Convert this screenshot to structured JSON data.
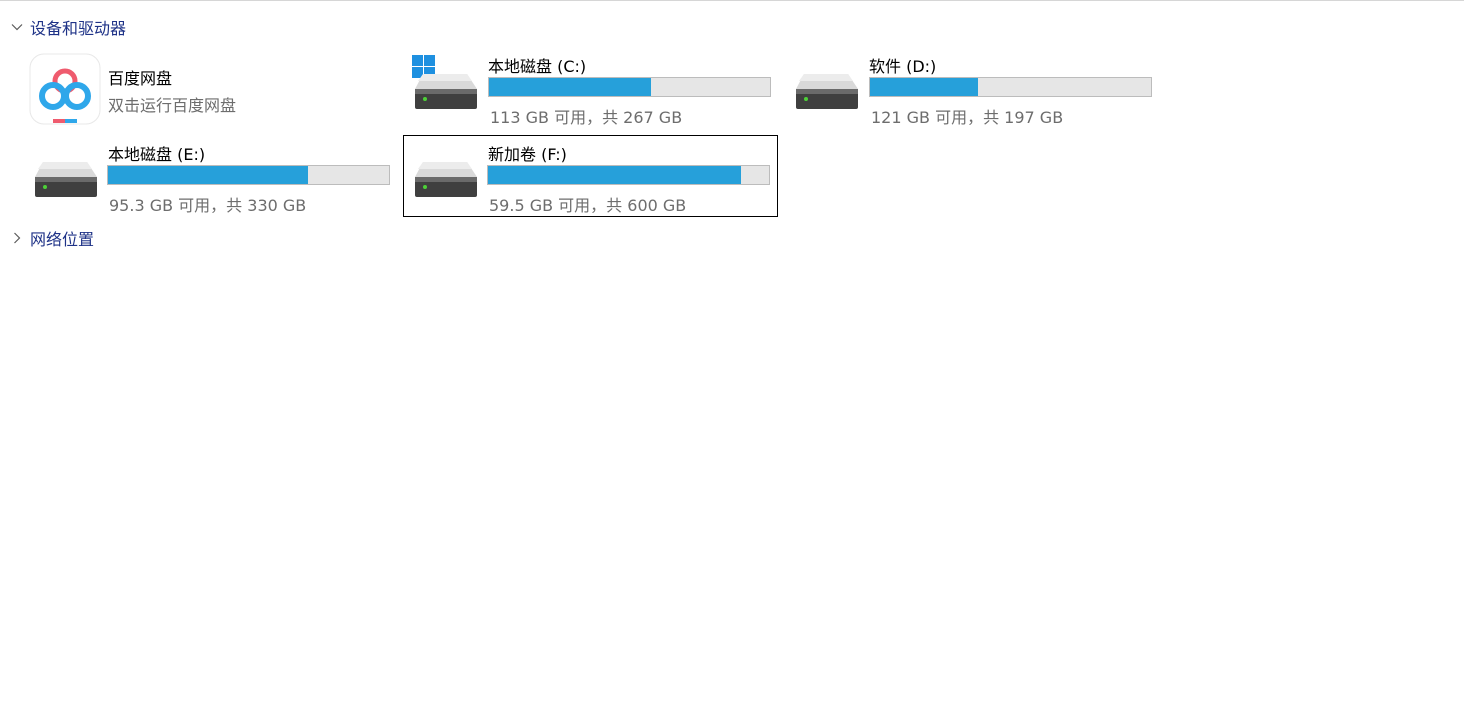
{
  "groups": {
    "devices": {
      "label": "设备和驱动器",
      "expanded": true
    },
    "network": {
      "label": "网络位置",
      "expanded": false
    }
  },
  "app": {
    "name": "百度网盘",
    "subtitle": "双击运行百度网盘",
    "icon": "baidu-netdisk-icon"
  },
  "drives": [
    {
      "id": "c",
      "name": "本地磁盘 (C:)",
      "usage": "113 GB 可用，共 267 GB",
      "used_fraction": 0.577,
      "icon": "system-drive-icon",
      "selected": false
    },
    {
      "id": "d",
      "name": "软件 (D:)",
      "usage": "121 GB 可用，共 197 GB",
      "used_fraction": 0.386,
      "icon": "hard-drive-icon",
      "selected": false
    },
    {
      "id": "e",
      "name": "本地磁盘 (E:)",
      "usage": "95.3 GB 可用，共 330 GB",
      "used_fraction": 0.711,
      "icon": "hard-drive-icon",
      "selected": false
    },
    {
      "id": "f",
      "name": "新加卷 (F:)",
      "usage": "59.5 GB 可用，共 600 GB",
      "used_fraction": 0.901,
      "icon": "hard-drive-icon",
      "selected": true
    }
  ],
  "colors": {
    "bar_fill": "#26a0da",
    "bar_track": "#e6e6e6",
    "header_text": "#1e3287",
    "sub_text": "#6d6d6d"
  }
}
